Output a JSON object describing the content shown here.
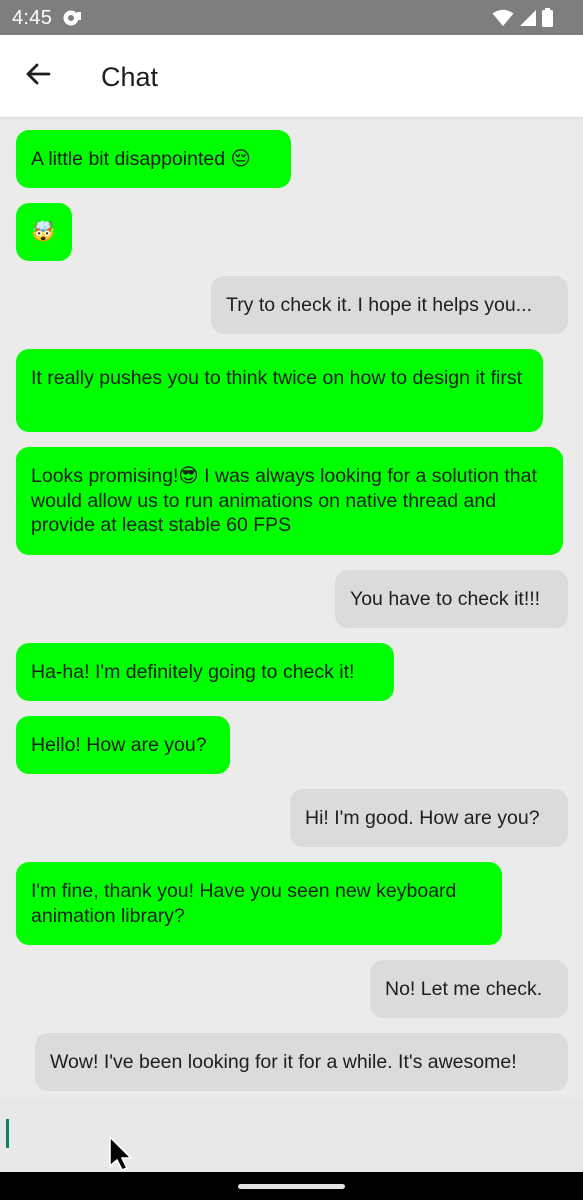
{
  "status_bar": {
    "time": "4:45"
  },
  "header": {
    "title": "Chat"
  },
  "messages": [
    {
      "direction": "incoming",
      "text": "A little bit disappointed 😔"
    },
    {
      "direction": "incoming",
      "text": "🤯"
    },
    {
      "direction": "outgoing",
      "text": "Try to check it. I hope it helps you..."
    },
    {
      "direction": "incoming",
      "text": "It really pushes you to think twice on how to design it first"
    },
    {
      "direction": "incoming",
      "text": "Looks promising!😎 I was always looking for a solution that would allow us to run animations on native thread and provide at least stable 60 FPS"
    },
    {
      "direction": "outgoing",
      "text": "You have to check it!!!"
    },
    {
      "direction": "incoming",
      "text": "Ha-ha! I'm definitely going to check it!"
    },
    {
      "direction": "incoming",
      "text": "Hello! How are you?"
    },
    {
      "direction": "outgoing",
      "text": "Hi! I'm good. How are you?"
    },
    {
      "direction": "incoming",
      "text": "I'm fine, thank you! Have you seen new keyboard animation library?"
    },
    {
      "direction": "outgoing",
      "text": "No! Let me check."
    },
    {
      "direction": "outgoing",
      "text": "Wow! I've been looking for it for a while. It's awesome!"
    }
  ],
  "composer": {
    "value": ""
  },
  "colors": {
    "incoming_bubble": "#00FF00",
    "outgoing_bubble": "#DCDBDC",
    "background": "#ECEBEC",
    "status_bar": "#7E7E7E",
    "caret": "#0E8065"
  },
  "icons": {
    "back": "arrow-left-icon",
    "notification": "chat-notification-icon",
    "wifi": "wifi-icon",
    "signal": "cellular-signal-icon",
    "battery": "battery-icon"
  }
}
